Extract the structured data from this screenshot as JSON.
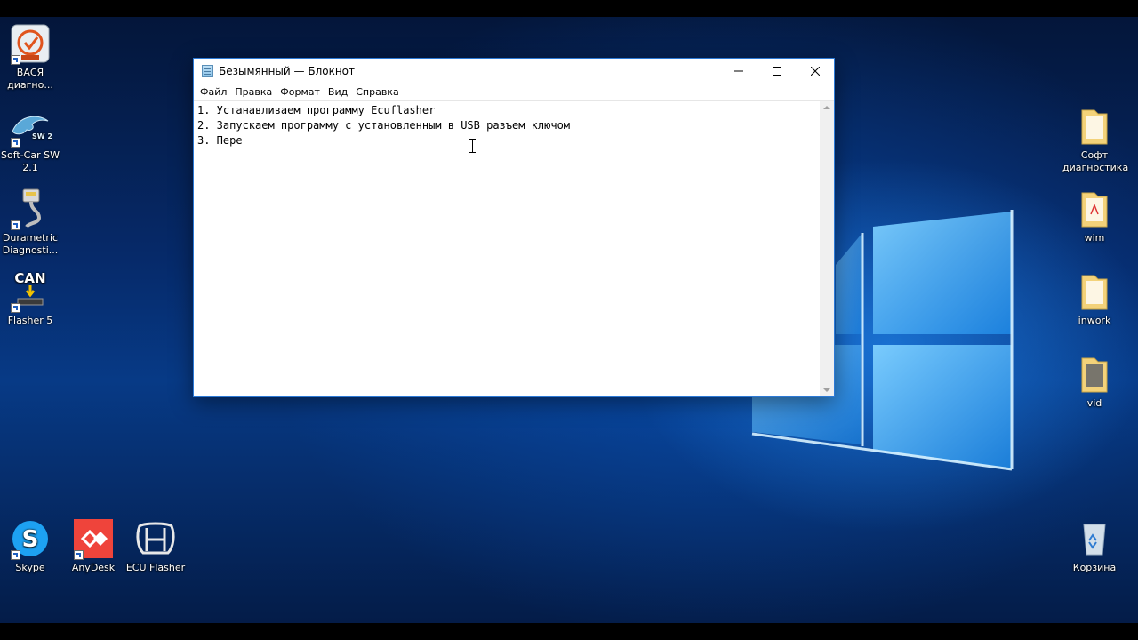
{
  "desktop": {
    "left_icons": [
      {
        "name": "vasya-diagnostika",
        "label": "ВАСЯ\nдиагно..."
      },
      {
        "name": "soft-car-sw",
        "label": "Soft-Car SW\n2.1"
      },
      {
        "name": "durametric",
        "label": "Durametric\nDiagnosti..."
      },
      {
        "name": "can-flasher",
        "label": "Flasher 5"
      }
    ],
    "can_text": "CAN",
    "soft_car_badge": "SW 2.1",
    "bottom_icons": [
      {
        "name": "skype",
        "label": "Skype"
      },
      {
        "name": "anydesk",
        "label": "AnyDesk"
      },
      {
        "name": "ecu-flasher",
        "label": "ECU Flasher"
      }
    ],
    "right_icons": [
      {
        "name": "soft-diagnostika-folder",
        "label": "Софт\nдиагностика"
      },
      {
        "name": "wim-folder",
        "label": "wim"
      },
      {
        "name": "inwork-folder",
        "label": "inwork"
      },
      {
        "name": "vid-folder",
        "label": "vid"
      },
      {
        "name": "recycle-bin",
        "label": "Корзина"
      }
    ],
    "colors": {
      "skype": "#1da1f2",
      "anydesk": "#ef443b",
      "folder": "#f3d27a",
      "window_border": "#2d7ad6"
    }
  },
  "notepad": {
    "title": "Безымянный — Блокнот",
    "menu": [
      "Файл",
      "Правка",
      "Формат",
      "Вид",
      "Справка"
    ],
    "controls": {
      "minimize": "minimize-icon",
      "maximize": "maximize-icon",
      "close": "close-icon"
    },
    "text": "1. Устанавливаем программу Ecuflasher\n2. Запускаем программу с установленным в USB разъем ключом\n3. Пере"
  }
}
